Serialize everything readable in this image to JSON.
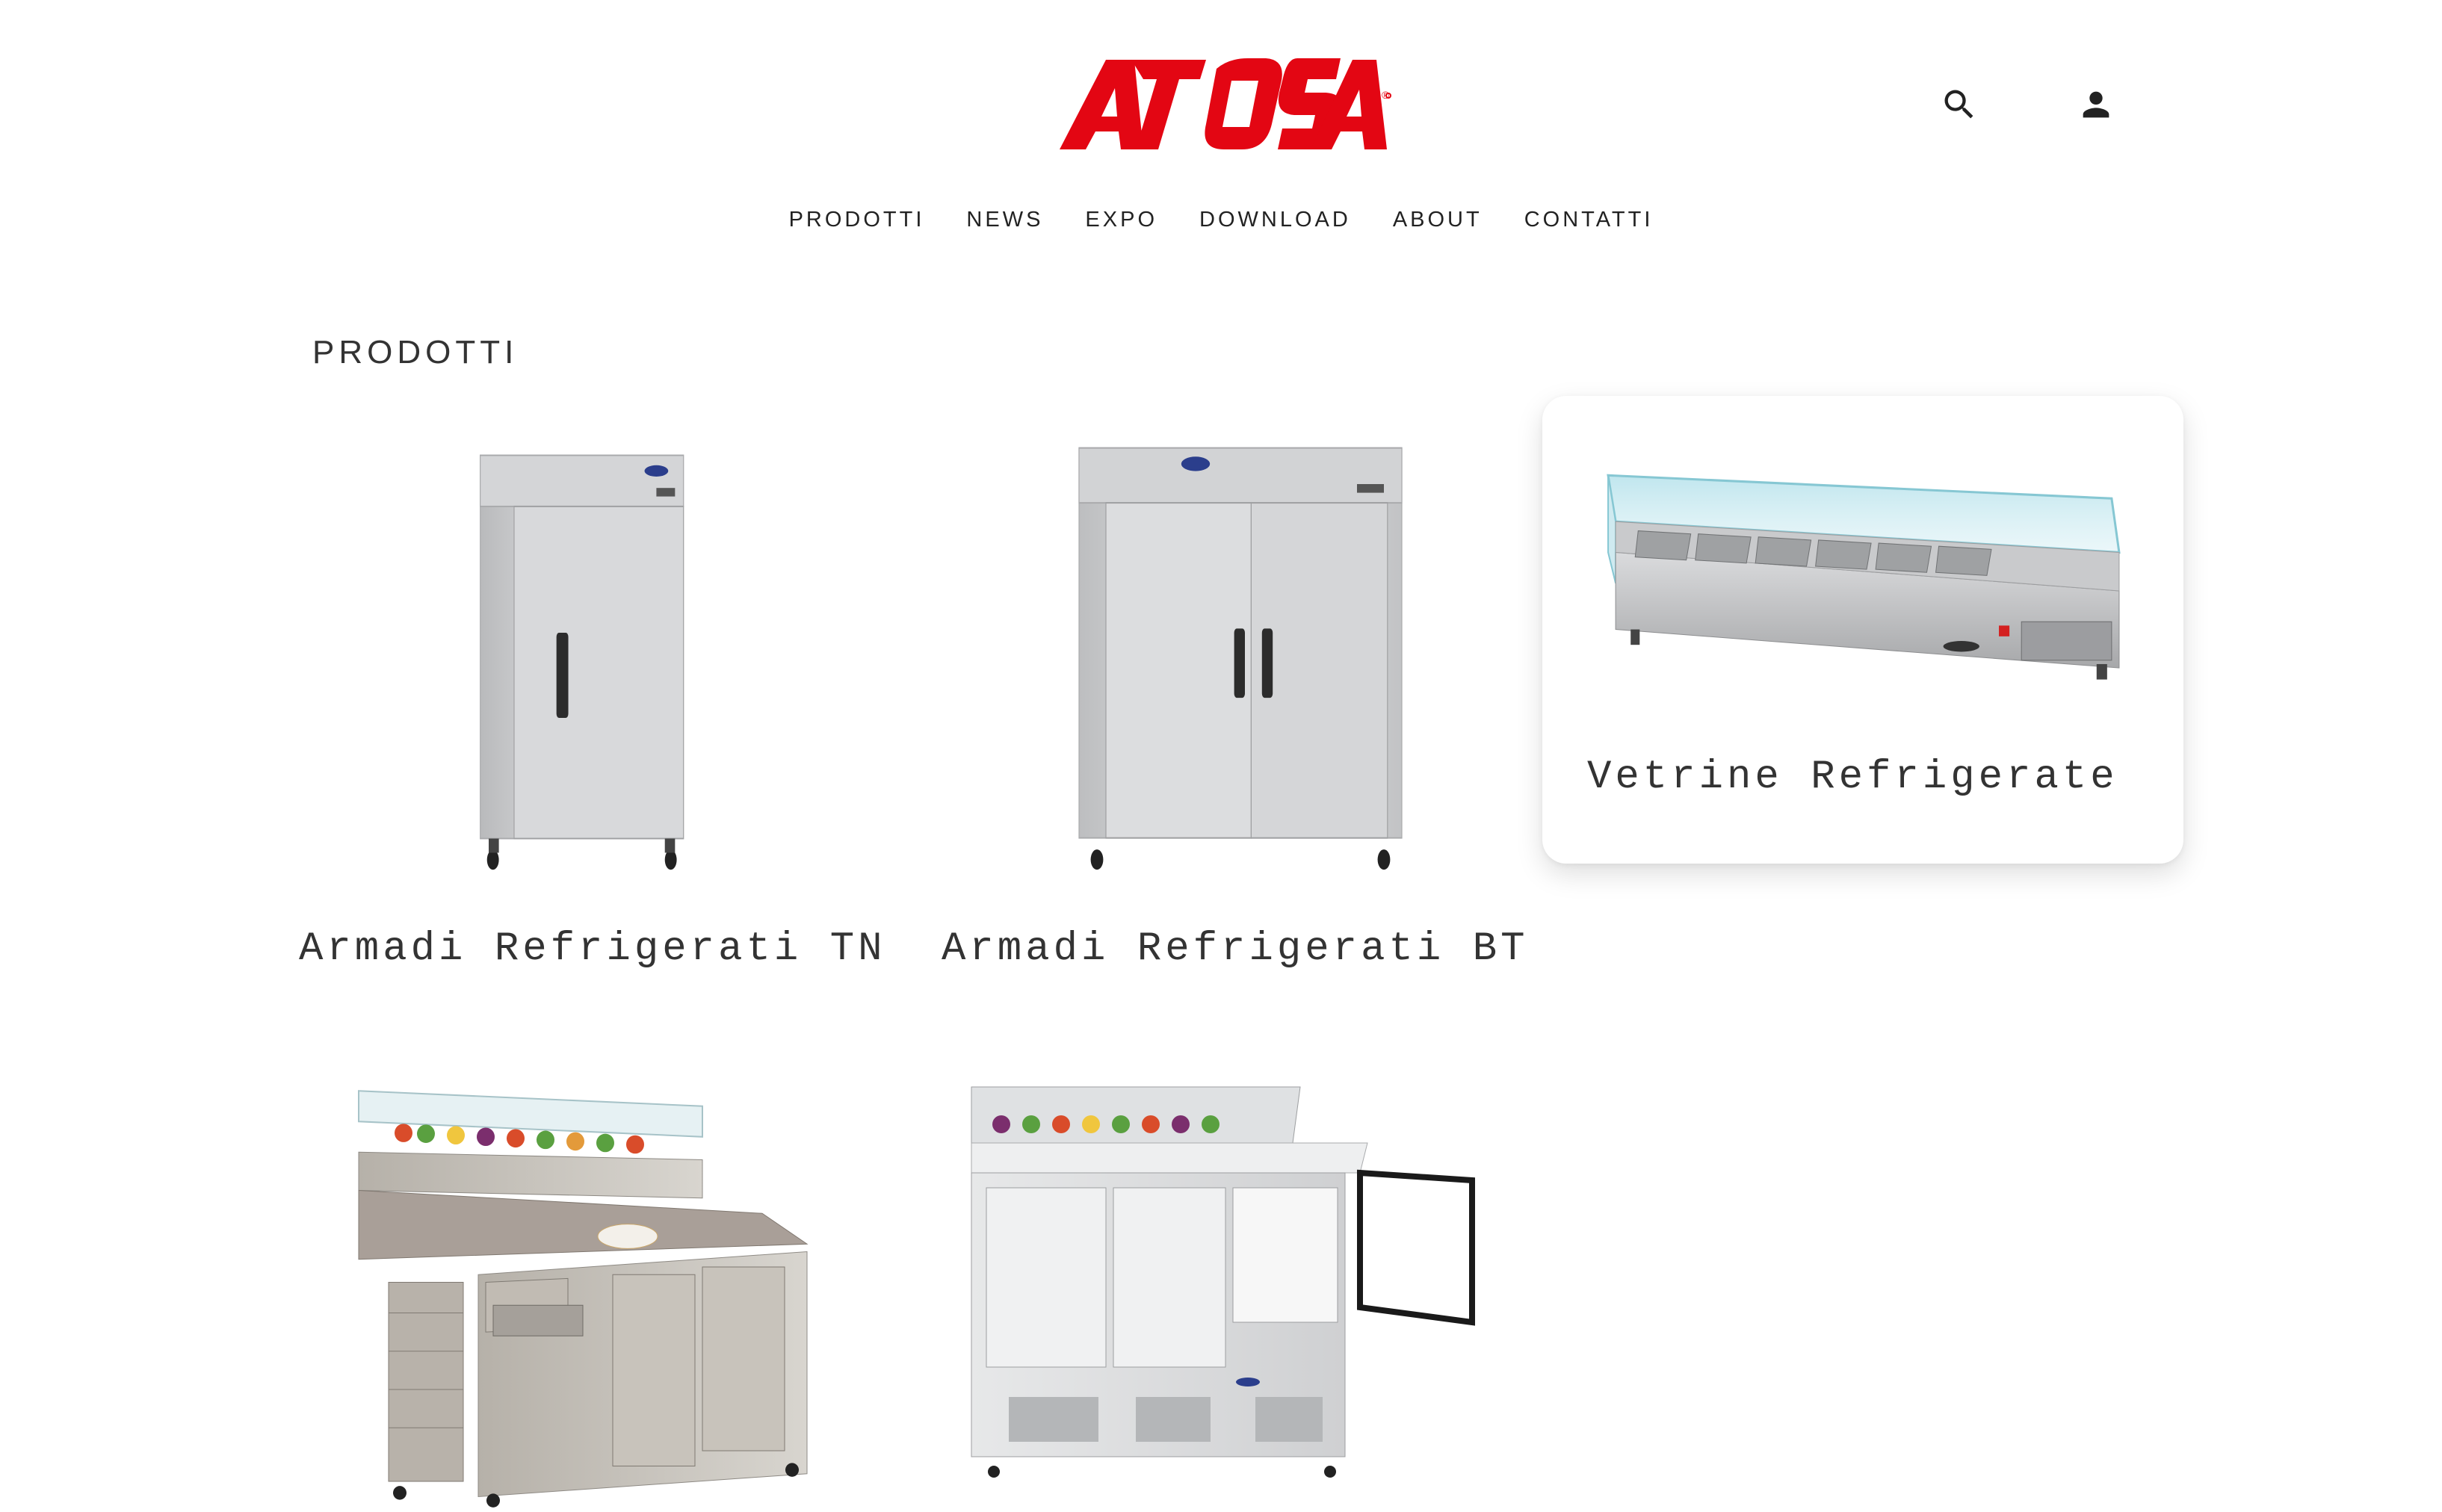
{
  "brand": {
    "name": "ATOSA",
    "registered_mark": "®",
    "color": "#e30613"
  },
  "header": {
    "search_icon": "search-icon",
    "account_icon": "person-icon"
  },
  "nav": {
    "items": [
      {
        "label": "PRODOTTI"
      },
      {
        "label": "NEWS"
      },
      {
        "label": "EXPO"
      },
      {
        "label": "DOWNLOAD"
      },
      {
        "label": "ABOUT"
      },
      {
        "label": "CONTATTI"
      }
    ]
  },
  "main": {
    "title": "PRODOTTI",
    "products": [
      {
        "label": "Armadi Refrigerati TN",
        "image": "single-door-refrigerator"
      },
      {
        "label": "Armadi Refrigerati BT",
        "image": "double-door-refrigerator"
      },
      {
        "label": "Vetrine Refrigerate",
        "image": "refrigerated-display-case",
        "state": "hover"
      },
      {
        "label": "",
        "image": "pizza-prep-counter"
      },
      {
        "label": "",
        "image": "saladette-counter"
      }
    ]
  },
  "colors": {
    "text": "#333333",
    "accent": "#e30613",
    "steel": "#c9cacc"
  }
}
